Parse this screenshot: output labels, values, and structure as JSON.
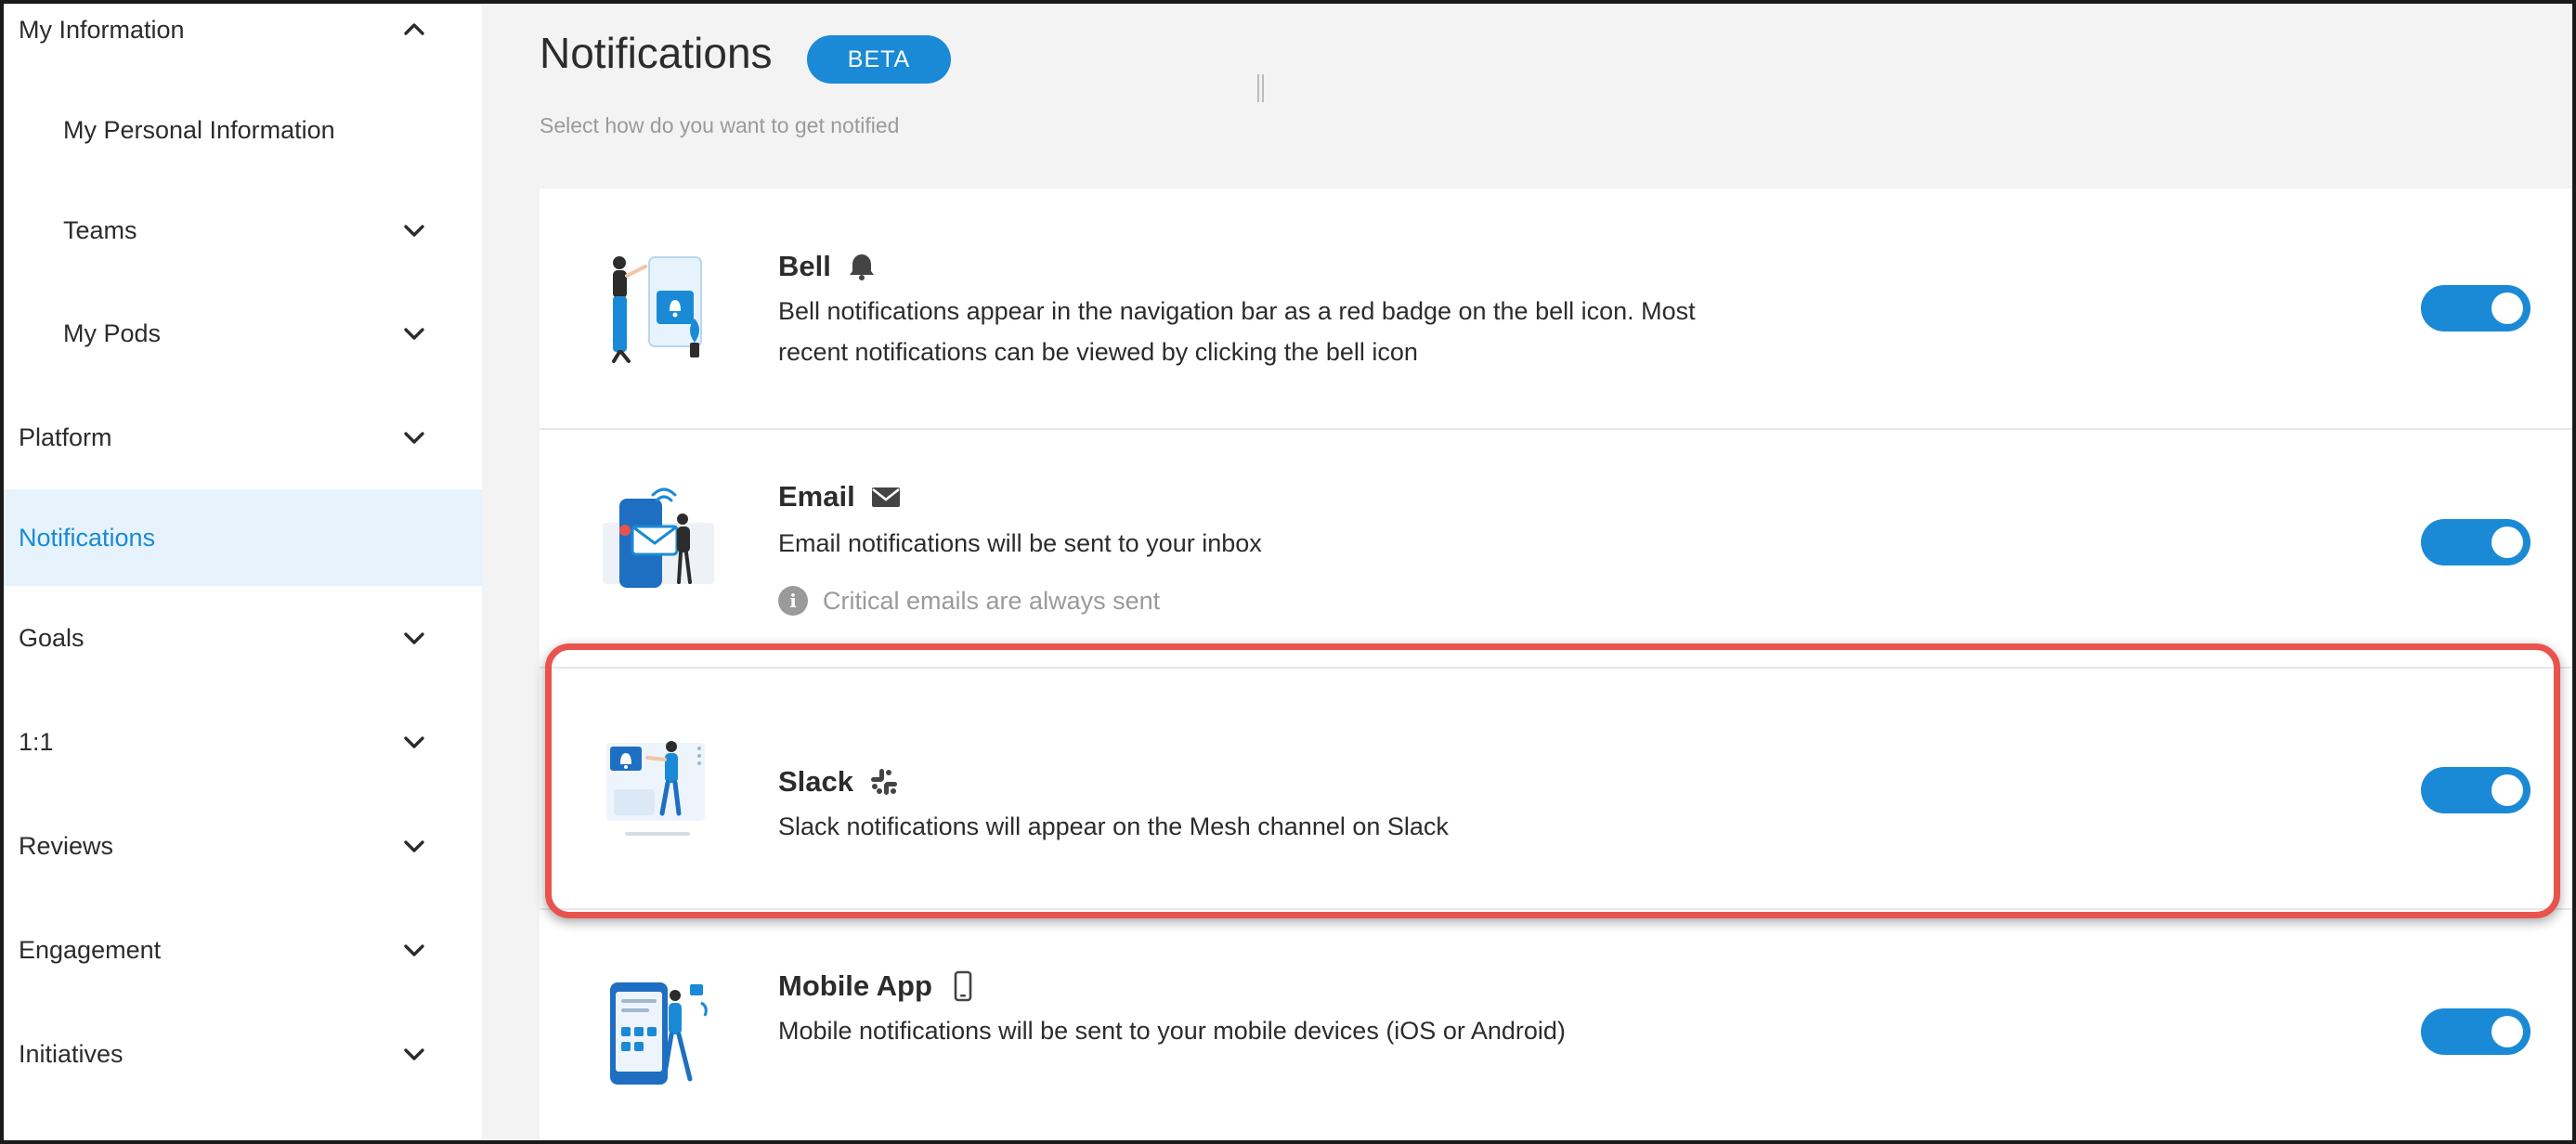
{
  "sidebar": {
    "items": [
      {
        "label": "My Information",
        "chevron": "chevron-up-icon"
      },
      {
        "label": "My Personal Information"
      },
      {
        "label": "Teams",
        "chevron": "chevron-down-icon"
      },
      {
        "label": "My Pods",
        "chevron": "chevron-down-icon"
      },
      {
        "label": "Platform",
        "chevron": "chevron-down-icon"
      },
      {
        "label": "Notifications",
        "active": true
      },
      {
        "label": "Goals",
        "chevron": "chevron-down-icon"
      },
      {
        "label": "1:1",
        "chevron": "chevron-down-icon"
      },
      {
        "label": "Reviews",
        "chevron": "chevron-down-icon"
      },
      {
        "label": "Engagement",
        "chevron": "chevron-down-icon"
      },
      {
        "label": "Initiatives",
        "chevron": "chevron-down-icon"
      }
    ]
  },
  "header": {
    "title": "Notifications",
    "badge": "BETA",
    "subtitle": "Select how do you want to get notified"
  },
  "channels": [
    {
      "title": "Bell",
      "icon": "bell-icon",
      "description": "Bell notifications appear in the navigation bar as a red badge on the bell icon. Most recent notifications can be viewed by clicking the bell icon",
      "enabled": true
    },
    {
      "title": "Email",
      "icon": "envelope-icon",
      "description": "Email notifications will be sent to your inbox",
      "note": "Critical emails are always sent",
      "note_icon": "info-icon",
      "enabled": true
    },
    {
      "title": "Slack",
      "icon": "slack-icon",
      "description": "Slack notifications will appear on the Mesh channel on Slack",
      "enabled": true,
      "highlighted": true
    },
    {
      "title": "Mobile App",
      "icon": "mobile-phone-icon",
      "description": "Mobile notifications will be sent to your mobile devices (iOS or Android)",
      "enabled": true
    }
  ],
  "colors": {
    "accent": "#1a8ad6",
    "active_bg": "#e6f3fc",
    "highlight_border": "#e8534d",
    "muted_text": "#9a9a9a"
  }
}
